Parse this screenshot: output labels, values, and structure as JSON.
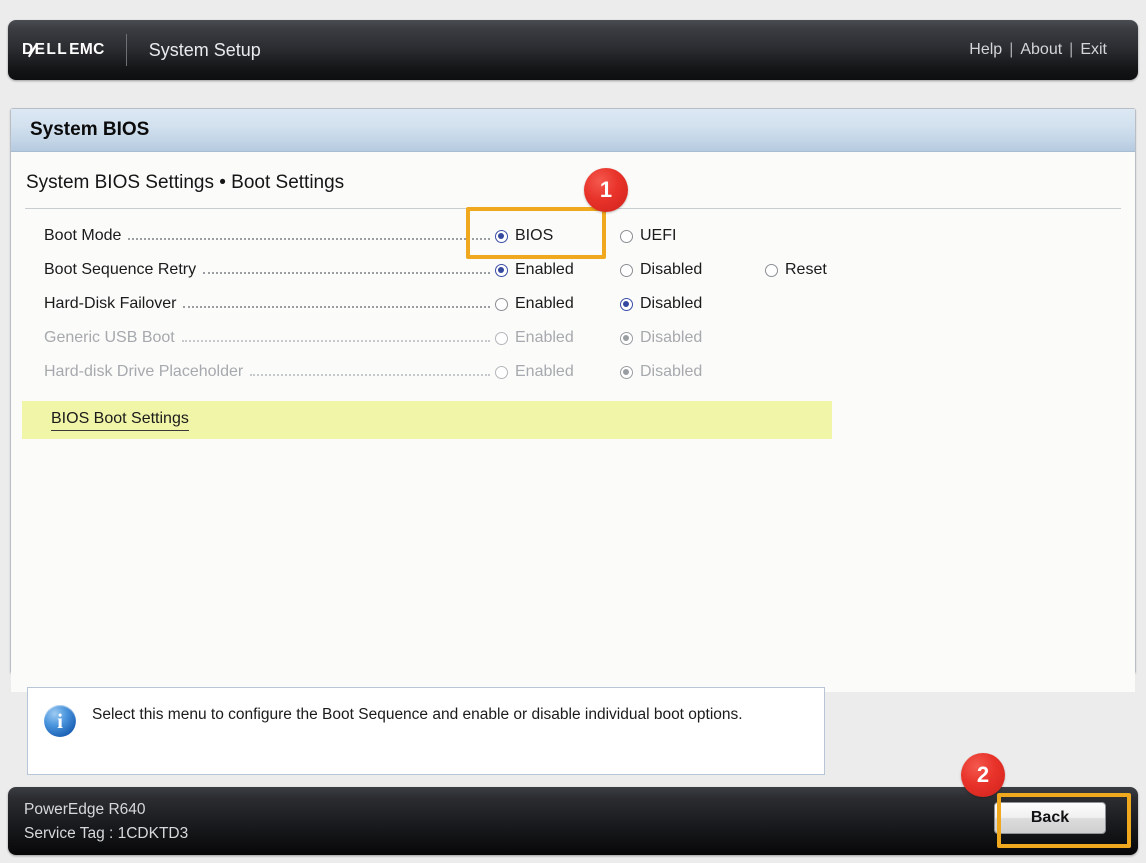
{
  "header": {
    "brand_dell": "DELL",
    "brand_emc": "EMC",
    "title": "System Setup",
    "links": [
      {
        "label": "Help"
      },
      {
        "label": "About"
      },
      {
        "label": "Exit"
      }
    ],
    "separator": "|"
  },
  "panel": {
    "title": "System BIOS",
    "section_heading": "System BIOS Settings • Boot Settings"
  },
  "settings": [
    {
      "label": "Boot Mode",
      "disabled": false,
      "options": [
        {
          "label": "BIOS",
          "selected": true
        },
        {
          "label": "UEFI",
          "selected": false
        }
      ]
    },
    {
      "label": "Boot Sequence Retry",
      "disabled": false,
      "options": [
        {
          "label": "Enabled",
          "selected": true
        },
        {
          "label": "Disabled",
          "selected": false
        },
        {
          "label": "Reset",
          "selected": false
        }
      ]
    },
    {
      "label": "Hard-Disk Failover",
      "disabled": false,
      "options": [
        {
          "label": "Enabled",
          "selected": false
        },
        {
          "label": "Disabled",
          "selected": true
        }
      ]
    },
    {
      "label": "Generic USB Boot",
      "disabled": true,
      "options": [
        {
          "label": "Enabled",
          "selected": false
        },
        {
          "label": "Disabled",
          "selected": true
        }
      ]
    },
    {
      "label": "Hard-disk Drive Placeholder",
      "disabled": true,
      "options": [
        {
          "label": "Enabled",
          "selected": false
        },
        {
          "label": "Disabled",
          "selected": true
        }
      ]
    }
  ],
  "link_row": {
    "label": "BIOS Boot Settings",
    "highlight_color": "#f1f5a8"
  },
  "info": {
    "icon": "info-icon",
    "text": "Select this menu to configure the Boot Sequence and enable or disable individual boot options."
  },
  "footer": {
    "model": "PowerEdge R640",
    "service_tag": "Service Tag : 1CDKTD3",
    "back_label": "Back"
  },
  "annotations": [
    {
      "number": "1",
      "target": "boot-mode-bios-radio",
      "color": "#e8332a"
    },
    {
      "number": "2",
      "target": "back-button",
      "color": "#e8332a"
    }
  ],
  "colors": {
    "highlight_box": "#f0a91e",
    "badge": "#e8332a",
    "radio_selected": "#3448a0",
    "panel_title_bg": "#c3d5e7"
  }
}
